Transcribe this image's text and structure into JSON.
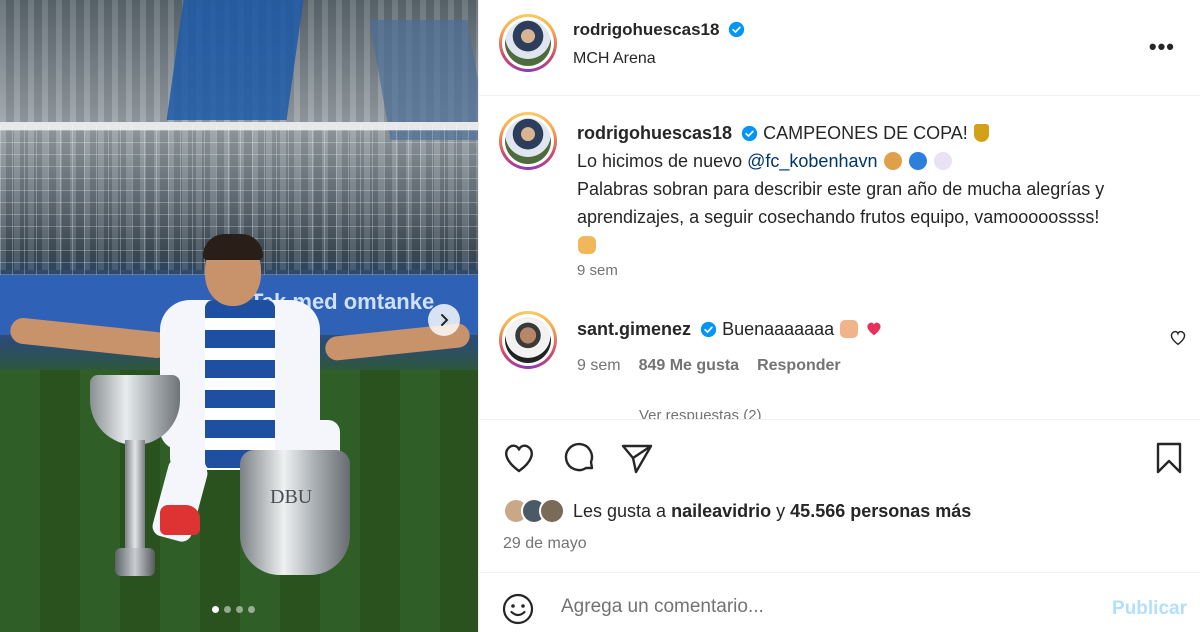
{
  "post": {
    "username": "rodrigohuescas18",
    "location": "MCH Arena",
    "more_label": "•••",
    "image": {
      "banner_text": "Tak med omtanke",
      "trophy_text": "DBU",
      "carousel_dots": 4,
      "active_dot": 1
    }
  },
  "caption": {
    "username": "rodrigohuescas18",
    "line1": "CAMPEONES DE COPA!",
    "line2_prefix": "Lo hicimos de nuevo",
    "mention": "@fc_kobenhavn",
    "line3": "Palabras sobran para describir este gran año de mucha alegrías y aprendizajes, a seguir cosechando frutos equipo, vamooooossss!",
    "time": "9 sem"
  },
  "comment": {
    "username": "sant.gimenez",
    "text": "Buenaaaaaaa",
    "time": "9 sem",
    "likes": "849 Me gusta",
    "reply_label": "Responder",
    "view_replies": "Ver respuestas (2)"
  },
  "likes": {
    "prefix": "Les gusta a",
    "user": "naileavidrio",
    "connector": "y",
    "others": "45.566 personas más"
  },
  "date": "29 de mayo",
  "comment_box": {
    "placeholder": "Agrega un comentario...",
    "publish_label": "Publicar"
  },
  "colors": {
    "verified": "#0095f6",
    "mention": "#00376b",
    "publish_disabled": "#b2dffc",
    "heart": "#ed4956"
  }
}
